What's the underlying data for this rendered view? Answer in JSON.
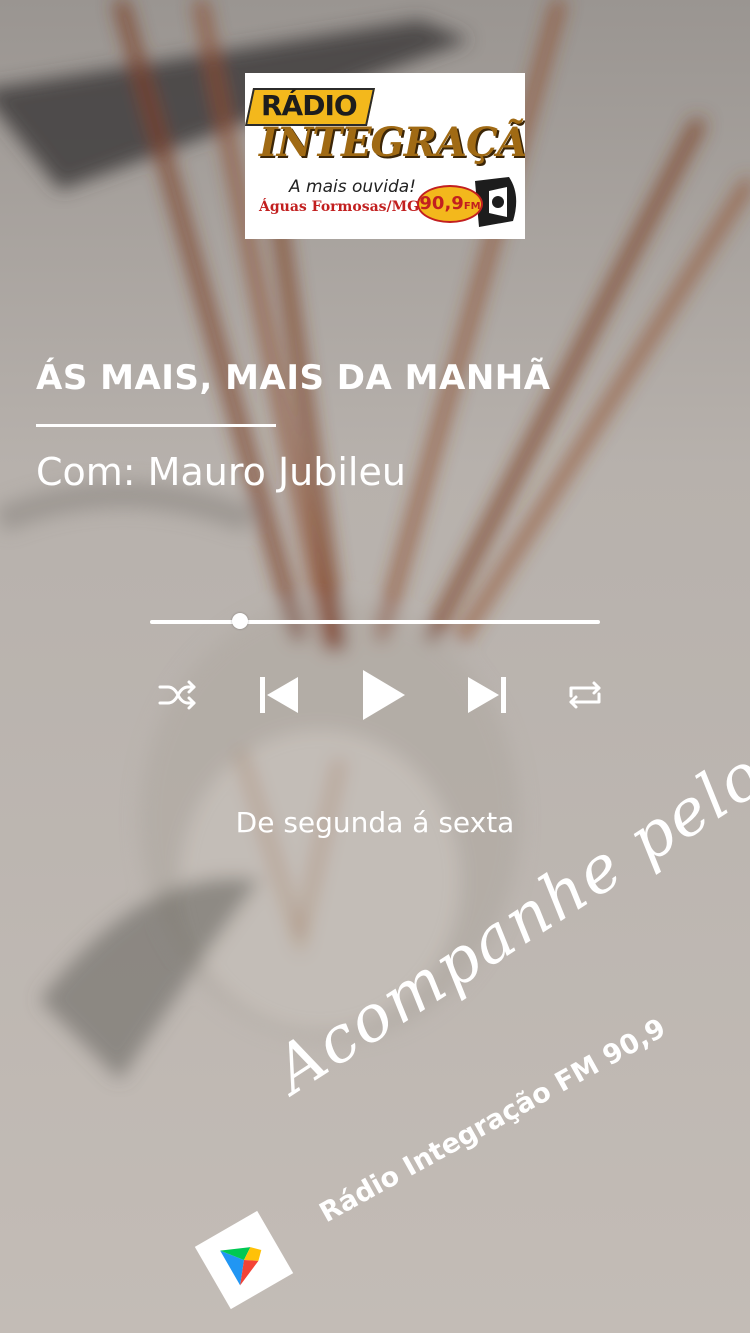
{
  "logo": {
    "badge": "RÁDIO",
    "name": "INTEGRAÇÃO",
    "slogan": "A mais ouvida!",
    "city": "Águas Formosas/MG",
    "frequency": "90,9",
    "band": "FM"
  },
  "program": {
    "title": "ÁS MAIS, MAIS DA MANHÃ",
    "host": "Com: Mauro Jubileu",
    "schedule": "De segunda á sexta"
  },
  "player": {
    "progress": 0.2,
    "controls": [
      "shuffle-icon",
      "previous-icon",
      "play-icon",
      "next-icon",
      "repeat-icon"
    ]
  },
  "footer": {
    "call_to_action": "Acompanhe pelo:",
    "station": "Rádio Integração FM 90,9",
    "app_store_icon": "google-play-icon"
  },
  "colors": {
    "background": "#c9c2bc",
    "logo_gold": "#f3b81c",
    "logo_brown": "#a06a14",
    "logo_red": "#c21f1f",
    "text": "#ffffff"
  }
}
